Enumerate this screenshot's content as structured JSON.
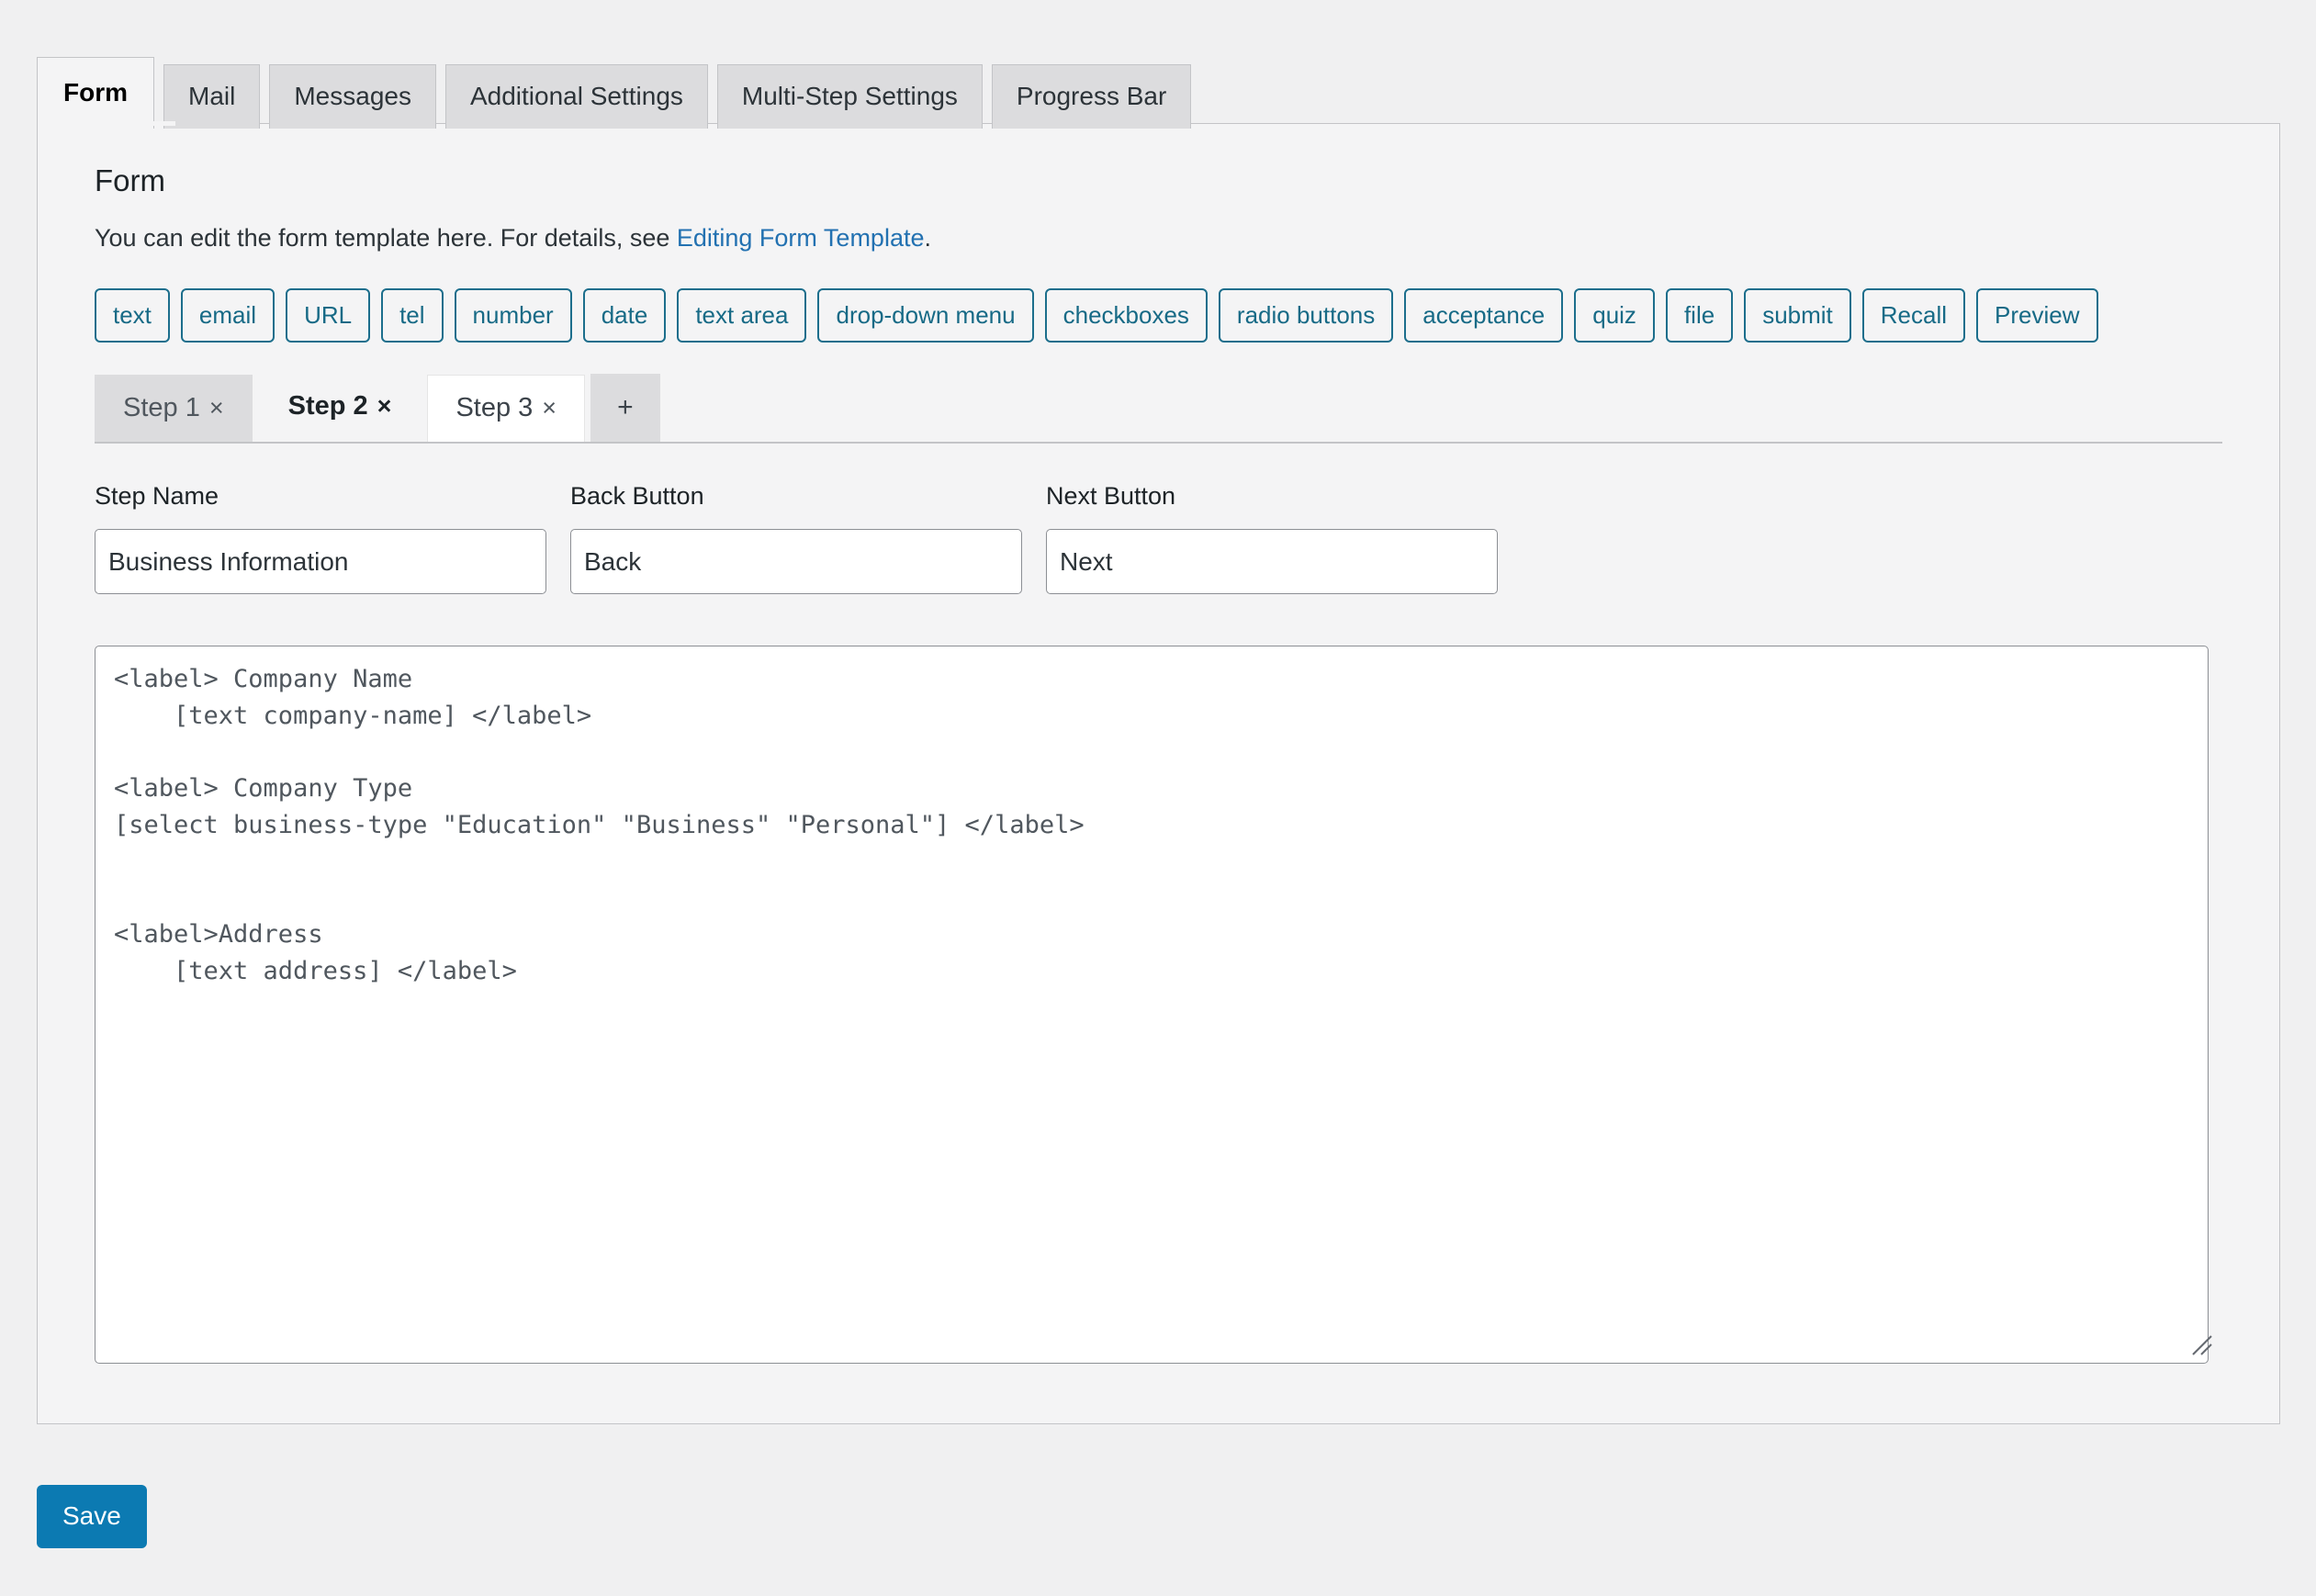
{
  "panel_tabs": [
    {
      "label": "Form",
      "active": true
    },
    {
      "label": "Mail",
      "active": false
    },
    {
      "label": "Messages",
      "active": false
    },
    {
      "label": "Additional Settings",
      "active": false
    },
    {
      "label": "Multi-Step Settings",
      "active": false
    },
    {
      "label": "Progress Bar",
      "active": false
    }
  ],
  "section": {
    "title": "Form",
    "desc_before": "You can edit the form template here. For details, see ",
    "desc_link": "Editing Form Template",
    "desc_after": "."
  },
  "tag_buttons": [
    "text",
    "email",
    "URL",
    "tel",
    "number",
    "date",
    "text area",
    "drop-down menu",
    "checkboxes",
    "radio buttons",
    "acceptance",
    "quiz",
    "file",
    "submit",
    "Recall",
    "Preview"
  ],
  "step_tabs": [
    {
      "label": "Step 1",
      "close": "×",
      "state": "inactive"
    },
    {
      "label": "Step 2",
      "close": "×",
      "state": "active"
    },
    {
      "label": "Step 3",
      "close": "×",
      "state": "plain"
    }
  ],
  "step_add_label": "+",
  "step_fields": {
    "step_name_label": "Step Name",
    "step_name_value": "Business Information",
    "back_button_label": "Back Button",
    "back_button_value": "Back",
    "next_button_label": "Next Button",
    "next_button_value": "Next"
  },
  "form_template": "<label> Company Name\n    [text company-name] </label>\n\n<label> Company Type\n[select business-type \"Education\" \"Business\" \"Personal\"] </label>\n\n\n<label>Address\n    [text address] </label>\n",
  "save_label": "Save",
  "colors": {
    "accent_link": "#2271b1",
    "tag_border": "#1c6e8c",
    "save_bg": "#0c7ab2",
    "page_bg": "#f0f0f1",
    "panel_bg": "#f4f4f5"
  }
}
